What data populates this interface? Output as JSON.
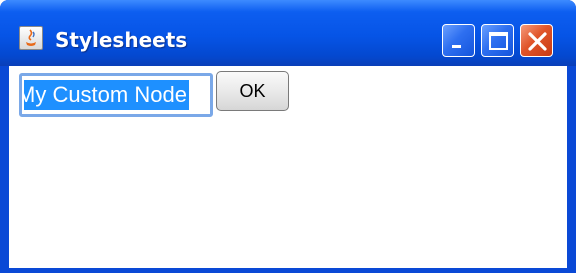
{
  "window": {
    "title": "Stylesheets",
    "controls": [
      "minimize-icon",
      "maximize-icon",
      "close-icon"
    ]
  },
  "form": {
    "text_value": "My Custom Node",
    "ok_label": "OK"
  },
  "colors": {
    "titlebar": "#0654e6",
    "selection": "#1e90ff",
    "close": "#e0552a"
  }
}
